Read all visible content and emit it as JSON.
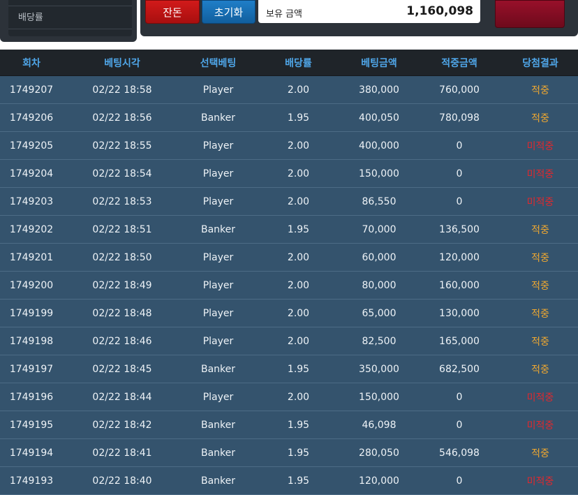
{
  "left_panel": {
    "odds_label": "배당률"
  },
  "toolbar": {
    "change_label": "잔돈",
    "reset_label": "초기화",
    "balance_label": "보유 금액",
    "balance_value": "1,160,098"
  },
  "table": {
    "headers": [
      "회차",
      "베팅시각",
      "선택베팅",
      "배당률",
      "베팅금액",
      "적중금액",
      "당첨결과"
    ],
    "rows": [
      {
        "round": "1749207",
        "time": "02/22 18:58",
        "pick": "Player",
        "odds": "2.00",
        "bet": "380,000",
        "win": "760,000",
        "result": "적중"
      },
      {
        "round": "1749206",
        "time": "02/22 18:56",
        "pick": "Banker",
        "odds": "1.95",
        "bet": "400,050",
        "win": "780,098",
        "result": "적중"
      },
      {
        "round": "1749205",
        "time": "02/22 18:55",
        "pick": "Player",
        "odds": "2.00",
        "bet": "400,000",
        "win": "0",
        "result": "미적중"
      },
      {
        "round": "1749204",
        "time": "02/22 18:54",
        "pick": "Player",
        "odds": "2.00",
        "bet": "150,000",
        "win": "0",
        "result": "미적중"
      },
      {
        "round": "1749203",
        "time": "02/22 18:53",
        "pick": "Player",
        "odds": "2.00",
        "bet": "86,550",
        "win": "0",
        "result": "미적중"
      },
      {
        "round": "1749202",
        "time": "02/22 18:51",
        "pick": "Banker",
        "odds": "1.95",
        "bet": "70,000",
        "win": "136,500",
        "result": "적중"
      },
      {
        "round": "1749201",
        "time": "02/22 18:50",
        "pick": "Player",
        "odds": "2.00",
        "bet": "60,000",
        "win": "120,000",
        "result": "적중"
      },
      {
        "round": "1749200",
        "time": "02/22 18:49",
        "pick": "Player",
        "odds": "2.00",
        "bet": "80,000",
        "win": "160,000",
        "result": "적중"
      },
      {
        "round": "1749199",
        "time": "02/22 18:48",
        "pick": "Player",
        "odds": "2.00",
        "bet": "65,000",
        "win": "130,000",
        "result": "적중"
      },
      {
        "round": "1749198",
        "time": "02/22 18:46",
        "pick": "Player",
        "odds": "2.00",
        "bet": "82,500",
        "win": "165,000",
        "result": "적중"
      },
      {
        "round": "1749197",
        "time": "02/22 18:45",
        "pick": "Banker",
        "odds": "1.95",
        "bet": "350,000",
        "win": "682,500",
        "result": "적중"
      },
      {
        "round": "1749196",
        "time": "02/22 18:44",
        "pick": "Player",
        "odds": "2.00",
        "bet": "150,000",
        "win": "0",
        "result": "미적중"
      },
      {
        "round": "1749195",
        "time": "02/22 18:42",
        "pick": "Banker",
        "odds": "1.95",
        "bet": "46,098",
        "win": "0",
        "result": "미적중"
      },
      {
        "round": "1749194",
        "time": "02/22 18:41",
        "pick": "Banker",
        "odds": "1.95",
        "bet": "280,050",
        "win": "546,098",
        "result": "적중"
      },
      {
        "round": "1749193",
        "time": "02/22 18:40",
        "pick": "Banker",
        "odds": "1.95",
        "bet": "120,000",
        "win": "0",
        "result": "미적중"
      }
    ]
  },
  "colors": {
    "header_text": "#4fa6e8",
    "win": "#f0a830",
    "lose": "#e0282e",
    "row_bg": "#34536d"
  }
}
